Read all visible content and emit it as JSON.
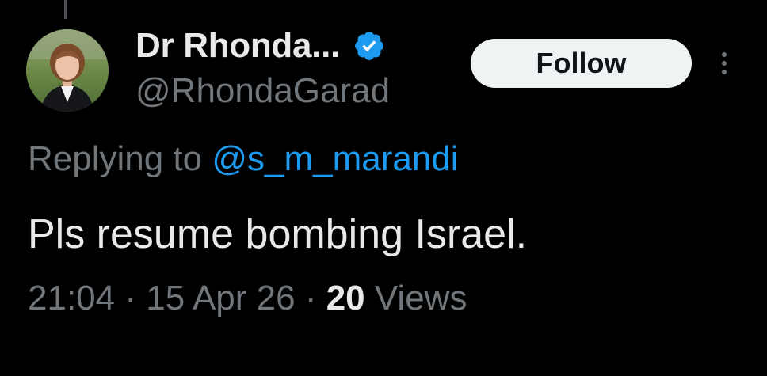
{
  "author": {
    "display_name": "Dr Rhonda...",
    "handle": "@RhondaGarad",
    "verified": true
  },
  "follow_button": {
    "label": "Follow"
  },
  "more_menu": {
    "icon": "more-vertical-icon"
  },
  "reply": {
    "prefix": "Replying to ",
    "handle": "@s_m_marandi"
  },
  "tweet": {
    "text": "Pls resume bombing Israel."
  },
  "meta": {
    "time": "21:04",
    "separator": " · ",
    "date": "15 Apr 26",
    "views_count": "20",
    "views_label": " Views"
  },
  "colors": {
    "background": "#000000",
    "text_primary": "#e7e9ea",
    "text_secondary": "#71767b",
    "accent_blue": "#1d9bf0",
    "button_bg": "#eff3f4"
  }
}
